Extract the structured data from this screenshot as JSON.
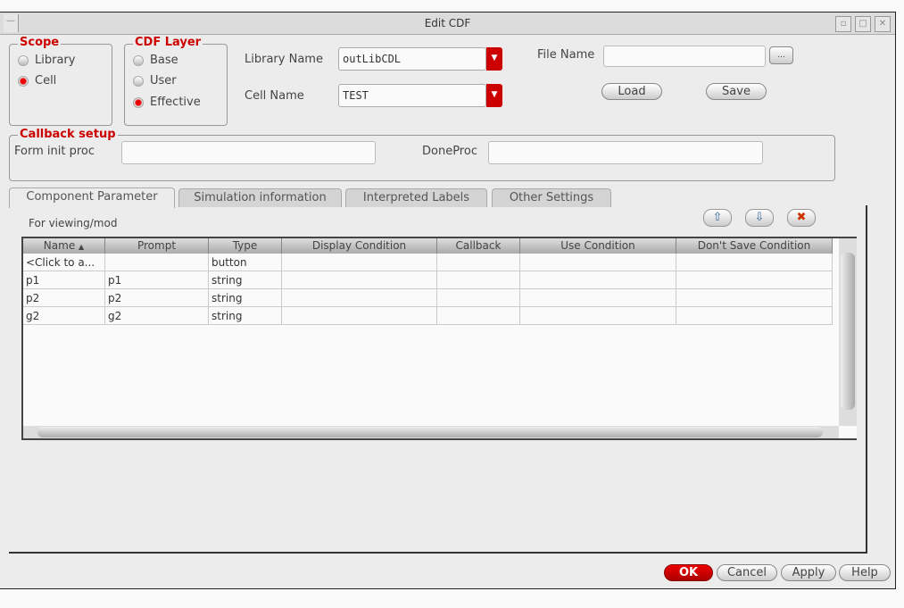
{
  "window": {
    "title": "Edit CDF",
    "menu_icon": "minus-icon",
    "controls": [
      "minimize",
      "maximize",
      "close"
    ]
  },
  "scope": {
    "label": "Scope",
    "options": [
      "Library",
      "Cell"
    ],
    "selected": "Cell"
  },
  "cdf_layer": {
    "label": "CDF Layer",
    "options": [
      "Base",
      "User",
      "Effective"
    ],
    "selected": "Effective"
  },
  "library_name": {
    "label": "Library Name",
    "value": "outLibCDL"
  },
  "cell_name": {
    "label": "Cell Name",
    "value": "TEST"
  },
  "file_name": {
    "label": "File Name",
    "value": "",
    "browse": "..."
  },
  "buttons": {
    "load": "Load",
    "save": "Save",
    "ok": "OK",
    "cancel": "Cancel",
    "apply": "Apply",
    "help": "Help"
  },
  "callback_setup": {
    "label": "Callback setup",
    "form_init_proc": "Form init proc",
    "form_init_value": "",
    "done_proc": "DoneProc",
    "done_value": ""
  },
  "tabs": [
    "Component Parameter",
    "Simulation information",
    "Interpreted Labels",
    "Other Settings"
  ],
  "active_tab": "Component Parameter",
  "panel_hint": "For viewing/mod",
  "table": {
    "columns": [
      "Name",
      "Prompt",
      "Type",
      "Display Condition",
      "Callback",
      "Use Condition",
      "Don't Save Condition"
    ],
    "rows": [
      [
        "<Click to a...",
        "",
        "button",
        "",
        "",
        "",
        ""
      ],
      [
        "p1",
        "p1",
        "string",
        "",
        "",
        "",
        ""
      ],
      [
        "p2",
        "p2",
        "string",
        "",
        "",
        "",
        ""
      ],
      [
        "g2",
        "g2",
        "string",
        "",
        "",
        "",
        ""
      ]
    ]
  },
  "colors": {
    "accent": "#cc0000"
  }
}
